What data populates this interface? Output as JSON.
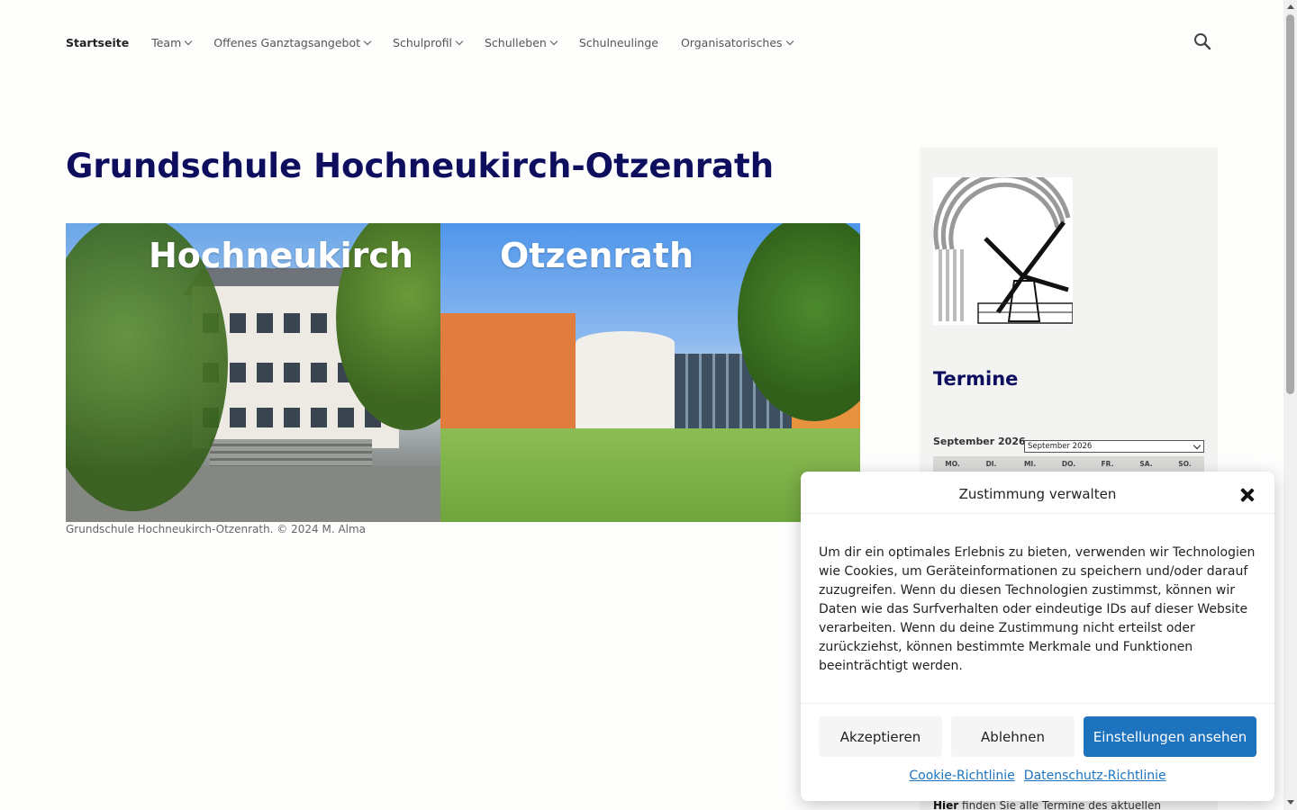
{
  "nav": {
    "items": [
      {
        "label": "Startseite",
        "active": true,
        "dropdown": false
      },
      {
        "label": "Team",
        "active": false,
        "dropdown": true
      },
      {
        "label": "Offenes Ganztagsangebot",
        "active": false,
        "dropdown": true
      },
      {
        "label": "Schulprofil",
        "active": false,
        "dropdown": true
      },
      {
        "label": "Schulleben",
        "active": false,
        "dropdown": true
      },
      {
        "label": "Schulneulinge",
        "active": false,
        "dropdown": false
      },
      {
        "label": "Organisatorisches",
        "active": false,
        "dropdown": true
      }
    ],
    "search_icon": "search-icon"
  },
  "main": {
    "title": "Grundschule Hochneukirch-Otzenrath",
    "hero": {
      "label_left": "Hochneukirch",
      "label_right": "Otzenrath",
      "caption": "Grundschule Hochneukirch-Otzenrath. © 2024 M. Alma"
    }
  },
  "sidebar": {
    "termine_heading": "Termine",
    "calendar": {
      "month_label": "September 2026",
      "selected_month": "September 2026",
      "weekdays": [
        "MO.",
        "DI.",
        "MI.",
        "DO.",
        "FR.",
        "SA.",
        "SO."
      ]
    },
    "hier_bold": "Hier",
    "hier_text": " finden Sie alle Termine des aktuellen"
  },
  "consent": {
    "title": "Zustimmung verwalten",
    "body": "Um dir ein optimales Erlebnis zu bieten, verwenden wir Technologien wie Cookies, um Geräteinformationen zu speichern und/oder darauf zuzugreifen. Wenn du diesen Technologien zustimmst, können wir Daten wie das Surfverhalten oder eindeutige IDs auf dieser Website verarbeiten. Wenn du deine Zustimmung nicht erteilst oder zurückziehst, können bestimmte Merkmale und Funktionen beeinträchtigt werden.",
    "accept_label": "Akzeptieren",
    "deny_label": "Ablehnen",
    "settings_label": "Einstellungen ansehen",
    "cookie_policy_label": "Cookie-Richtlinie",
    "privacy_policy_label": "Datenschutz-Richtlinie",
    "accent_color": "#1e73be"
  }
}
